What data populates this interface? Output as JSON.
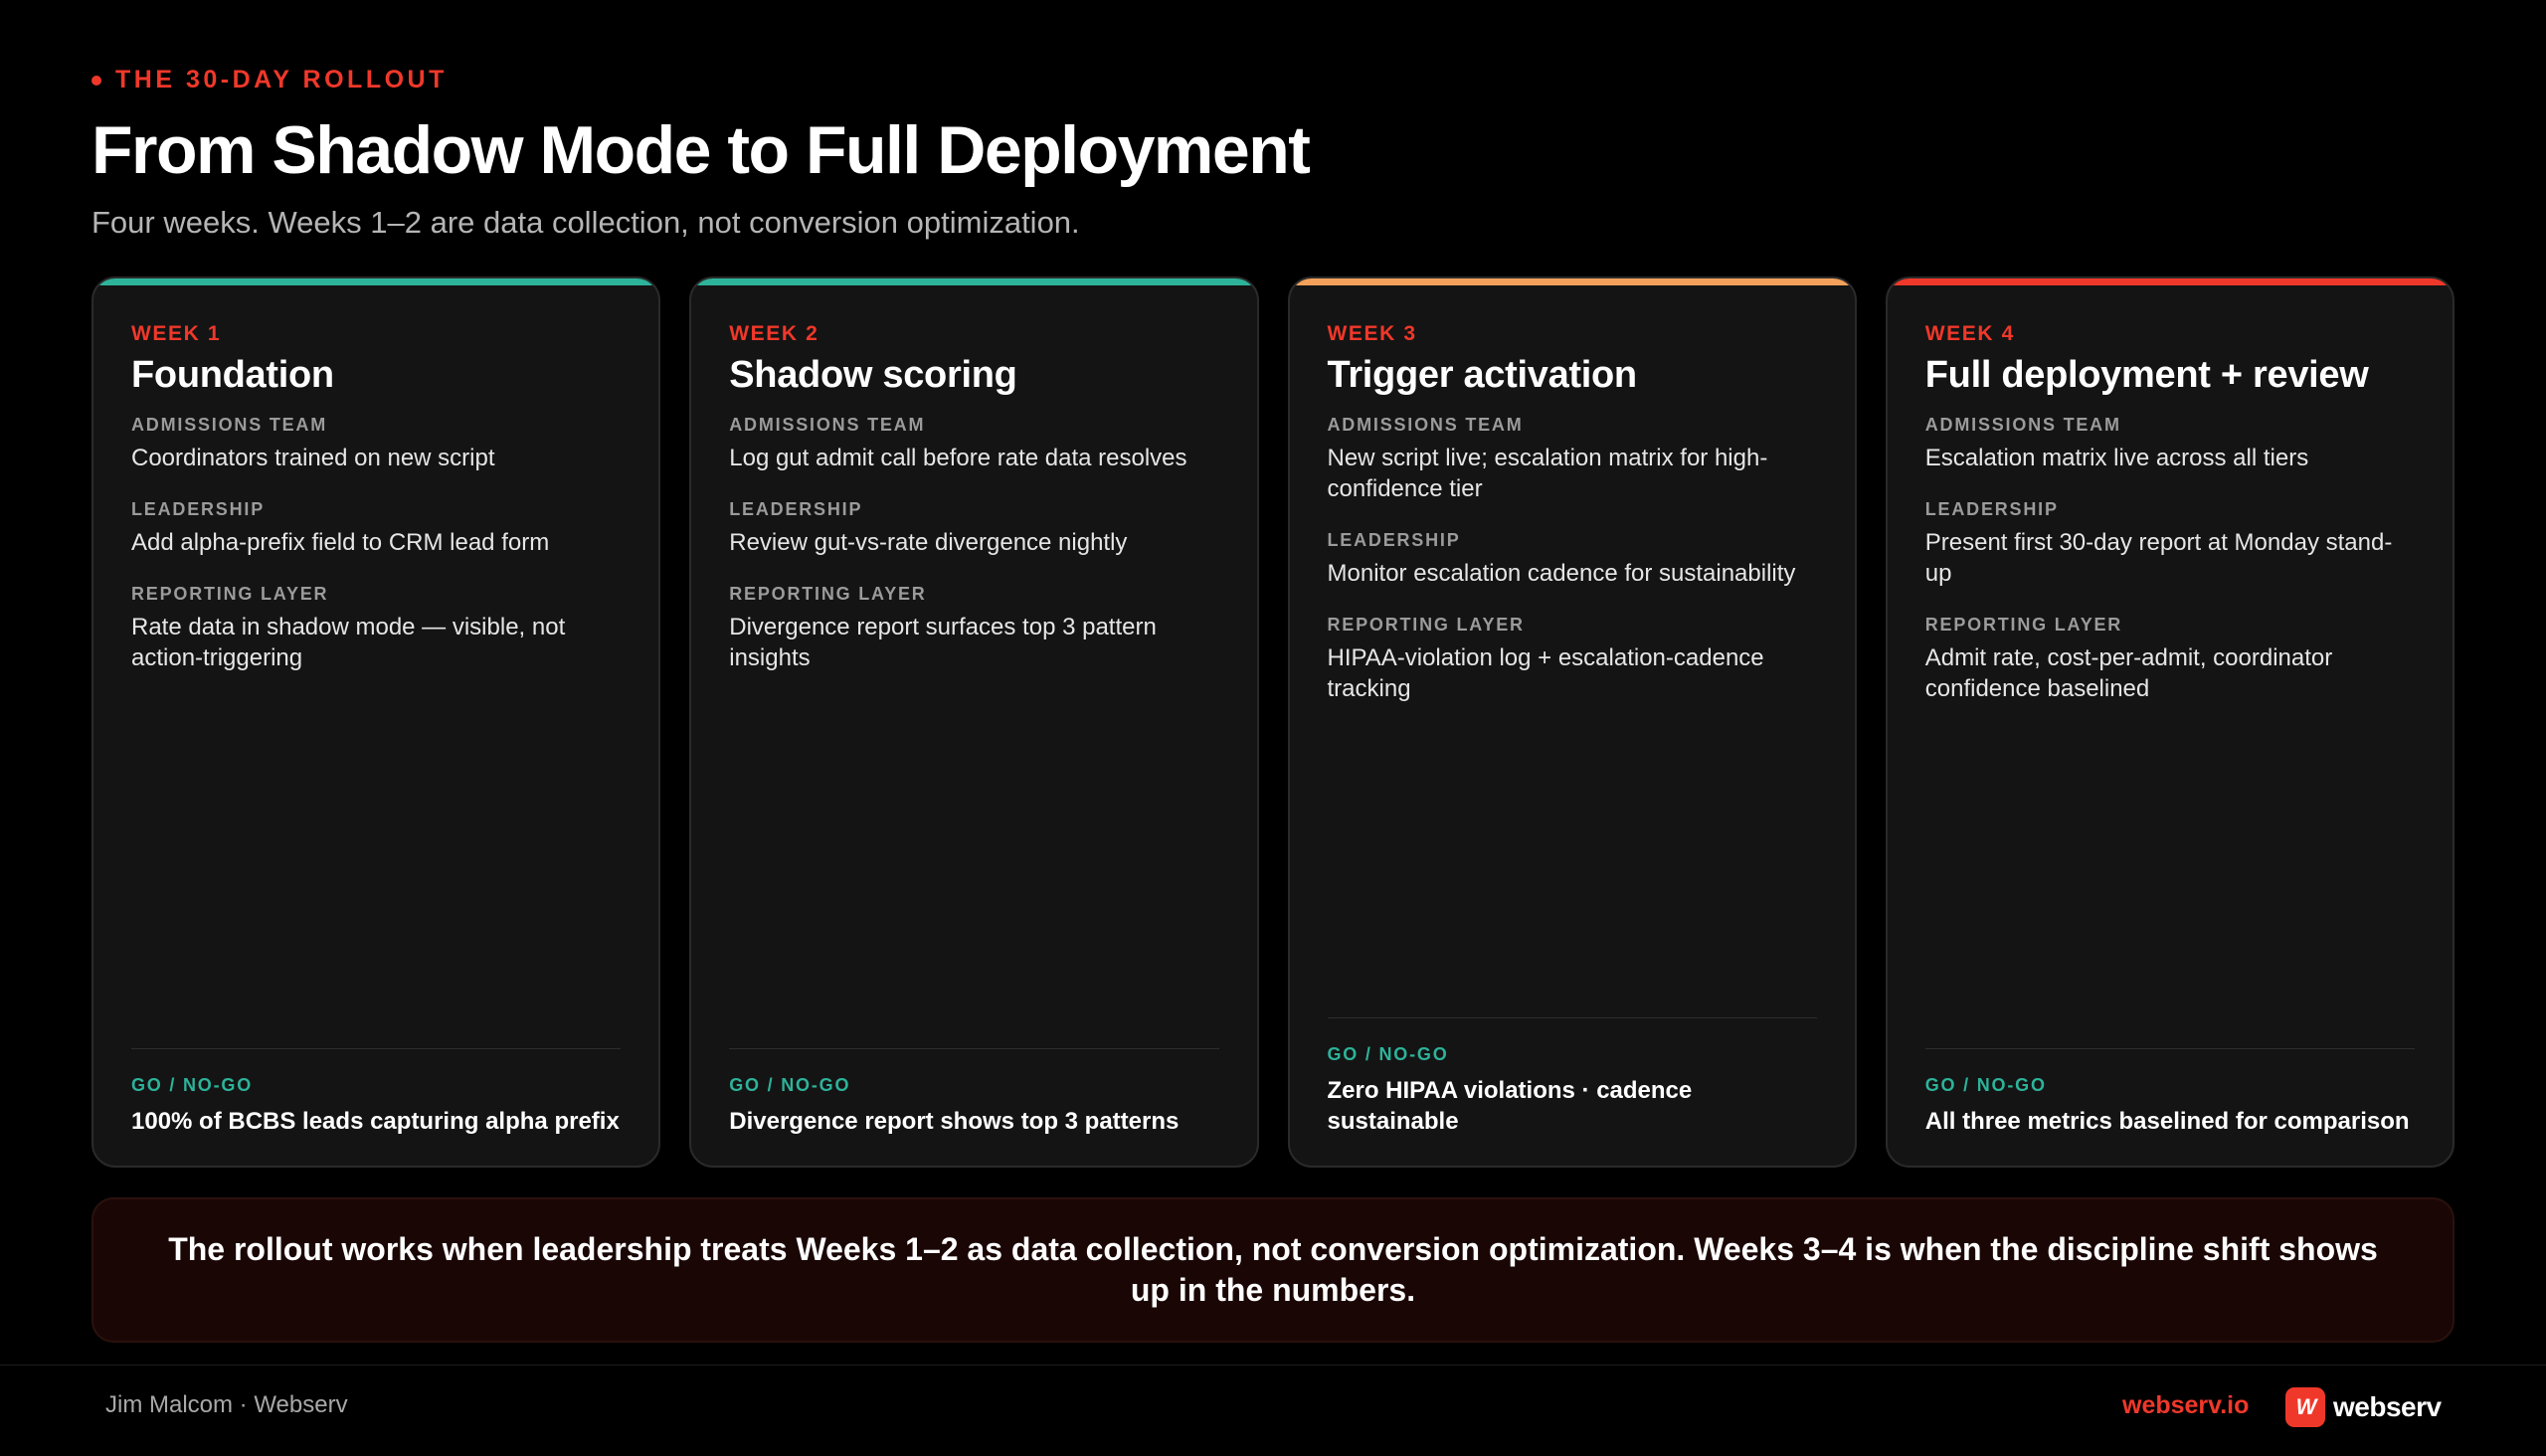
{
  "header": {
    "eyebrow": "THE 30-DAY ROLLOUT",
    "title": "From Shadow Mode to Full Deployment",
    "subtitle": "Four weeks. Weeks 1–2 are data collection, not conversion optimization."
  },
  "colors": {
    "accent_red": "#f0382a",
    "accent_teal": "#2db39a",
    "accent_orange": "#f2a05a"
  },
  "cards": [
    {
      "week": "WEEK 1",
      "title": "Foundation",
      "sections": [
        {
          "label": "ADMISSIONS TEAM",
          "text": "Coordinators trained on new script"
        },
        {
          "label": "LEADERSHIP",
          "text": "Add alpha-prefix field to CRM lead form"
        },
        {
          "label": "REPORTING LAYER",
          "text": "Rate data in shadow mode — visible, not action-triggering"
        }
      ],
      "gonogo_label": "GO / NO-GO",
      "gonogo_text": "100% of BCBS leads capturing alpha prefix"
    },
    {
      "week": "WEEK 2",
      "title": "Shadow scoring",
      "sections": [
        {
          "label": "ADMISSIONS TEAM",
          "text": "Log gut admit call before rate data resolves"
        },
        {
          "label": "LEADERSHIP",
          "text": "Review gut-vs-rate divergence nightly"
        },
        {
          "label": "REPORTING LAYER",
          "text": "Divergence report surfaces top 3 pattern insights"
        }
      ],
      "gonogo_label": "GO / NO-GO",
      "gonogo_text": "Divergence report shows top 3 patterns"
    },
    {
      "week": "WEEK 3",
      "title": "Trigger activation",
      "sections": [
        {
          "label": "ADMISSIONS TEAM",
          "text": "New script live; escalation matrix for high-confidence tier"
        },
        {
          "label": "LEADERSHIP",
          "text": "Monitor escalation cadence for sustainability"
        },
        {
          "label": "REPORTING LAYER",
          "text": "HIPAA-violation log + escalation-cadence tracking"
        }
      ],
      "gonogo_label": "GO / NO-GO",
      "gonogo_text": "Zero HIPAA violations · cadence sustainable"
    },
    {
      "week": "WEEK 4",
      "title": "Full deployment + review",
      "sections": [
        {
          "label": "ADMISSIONS TEAM",
          "text": "Escalation matrix live across all tiers"
        },
        {
          "label": "LEADERSHIP",
          "text": "Present first 30-day report at Monday stand-up"
        },
        {
          "label": "REPORTING LAYER",
          "text": "Admit rate, cost-per-admit, coordinator confidence baselined"
        }
      ],
      "gonogo_label": "GO / NO-GO",
      "gonogo_text": "All three metrics baselined for comparison"
    }
  ],
  "callout": "The rollout works when leadership treats Weeks 1–2 as data collection, not conversion optimization. Weeks 3–4 is when the discipline shift shows up in the numbers.",
  "footer": {
    "author": "Jim Malcom · Webserv",
    "link": "webserv.io",
    "logo_mark": "W",
    "logo_text": "webserv"
  }
}
